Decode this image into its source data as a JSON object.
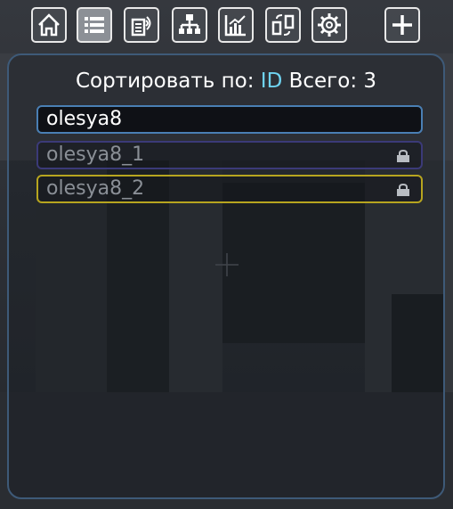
{
  "toolbar": {
    "buttons": [
      {
        "icon": "home-icon",
        "active": false
      },
      {
        "icon": "list-icon",
        "active": true
      },
      {
        "icon": "wireless-device-icon",
        "active": false
      },
      {
        "icon": "network-tree-icon",
        "active": false
      },
      {
        "icon": "chart-icon",
        "active": false
      },
      {
        "icon": "transfer-icon",
        "active": false
      },
      {
        "icon": "gear-icon",
        "active": false
      },
      {
        "icon": "plus-icon",
        "active": false
      }
    ]
  },
  "header": {
    "sort_label": "Сортировать по: ",
    "sort_value": "ID",
    "total_label": "Всего:",
    "total_value": "3"
  },
  "list": {
    "items": [
      {
        "name": "olesya8",
        "locked": false,
        "border": "#4a7fb4",
        "text_color": "#ffffff"
      },
      {
        "name": "olesya8_1",
        "locked": true,
        "border": "#3b3a78",
        "text_color": "#8a8f96"
      },
      {
        "name": "olesya8_2",
        "locked": true,
        "border": "#b7a51f",
        "text_color": "#8a8f96"
      }
    ]
  },
  "colors": {
    "accent": "#6fd3f0",
    "panel_border": "#3e5a78"
  }
}
